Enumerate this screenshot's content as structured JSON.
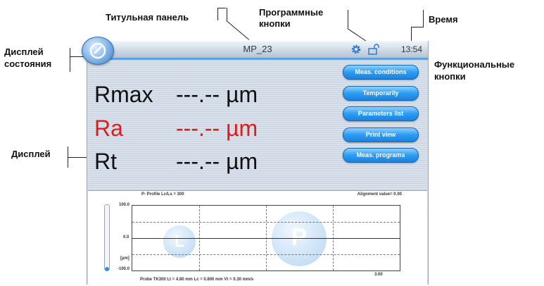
{
  "annotations": {
    "title_panel": "Титульная панель",
    "program_buttons": [
      "Программные",
      "кнопки"
    ],
    "time": "Время",
    "status_display": [
      "Дисплей",
      "состояния"
    ],
    "function_buttons": [
      "Функциональные",
      "кнопки"
    ],
    "display": "Дисплей"
  },
  "titlebar": {
    "title": "MP_23",
    "time": "13:54",
    "gear_icon": "gear-icon",
    "lock_icon": "lock-icon",
    "logo_icon": "status-logo-icon"
  },
  "measurements": [
    {
      "name": "Rmax",
      "value": "---.-- µm",
      "color": "#111111"
    },
    {
      "name": "Ra",
      "value": "---.-- µm",
      "color": "#e01b1b"
    },
    {
      "name": "Rt",
      "value": "---.-- µm",
      "color": "#111111"
    }
  ],
  "function_buttons": [
    "Meas. conditions",
    "Temporarily",
    "Parameters list",
    "Print view",
    "Meas. programs"
  ],
  "graph": {
    "header_left": "P- Profile Lc/Ls = 300",
    "header_right": "Alignment value= 0.00",
    "y_top": "100.0",
    "y_mid": "0.0",
    "y_unit": "[µm]",
    "y_bottom": "-100.0",
    "x_end": "3.00",
    "footer": "Probe TK300   Lt = 4.80 mm  Lc = 0.800 mm   Vt = 0.30 mm/s",
    "watermark_letters": [
      "L",
      "P"
    ]
  },
  "colors": {
    "accent": "#5f9fe3",
    "button": "#2c9cf2",
    "highlight_value": "#e01b1b"
  }
}
